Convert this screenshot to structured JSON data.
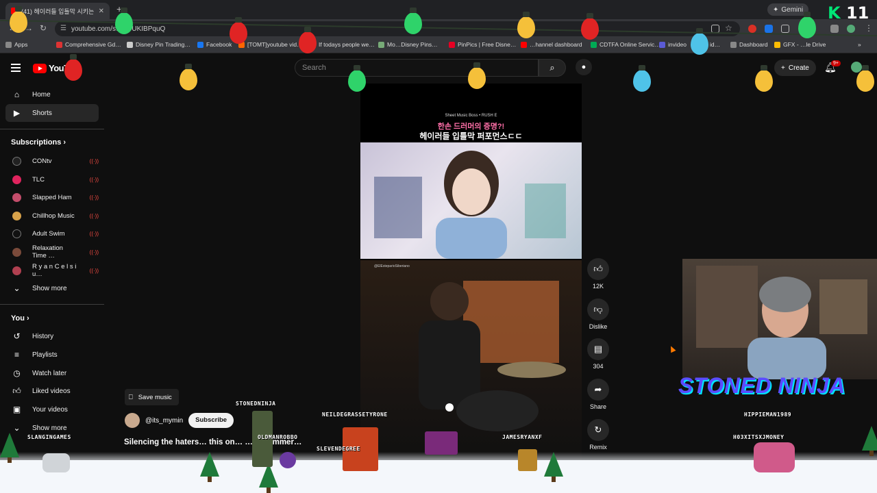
{
  "browser": {
    "tab_title": "(41) 헤이러들 입틀막 시키는",
    "new_tab_symbol": "+",
    "gemini_label": "Gemini",
    "url": "youtube.com/s…EYUKIBPquQ",
    "bookmarks": [
      "Apps",
      "Comprehensive Gd…",
      "Disney Pin Trading…",
      "Facebook",
      "[TOMT]youtube vid…",
      "If todays people we…",
      "Mo…Disney Pins…",
      "PinPics | Free Disne…",
      "…hannel dashboard",
      "CDTFA Online Servic…",
      "invideo",
      "id…",
      "Dashboard",
      "GFX - …le Drive"
    ],
    "stream_counter": "11"
  },
  "header": {
    "logo_text": "YouT",
    "search_placeholder": "Search",
    "create_label": "Create",
    "notif_count": "9+"
  },
  "sidebar": {
    "home": "Home",
    "shorts": "Shorts",
    "subscriptions_title": "Subscriptions",
    "subscriptions": [
      {
        "name": "CONtv",
        "color": "#222222"
      },
      {
        "name": "TLC",
        "color": "#e0245e"
      },
      {
        "name": "Slapped Ham",
        "color": "#c44d6b"
      },
      {
        "name": "Chillhop Music",
        "color": "#d8a24a"
      },
      {
        "name": "Adult Swim",
        "color": "#111111"
      },
      {
        "name": "Relaxation Time …",
        "color": "#7a4a3a"
      },
      {
        "name": "R y a n C e l s i u…",
        "color": "#b04050"
      }
    ],
    "show_more_1": "Show more",
    "you_title": "You",
    "you_items": [
      "History",
      "Playlists",
      "Watch later",
      "Liked videos",
      "Your videos"
    ],
    "show_more_2": "Show more"
  },
  "short": {
    "overlay_label": "Sheet Music Boss • RUSH E",
    "korean_line1": "한손 드러머의 증명?!",
    "korean_line2": "헤이러들 입틀막 퍼포먼스ㄷㄷ",
    "handle_overlay": "@ElEsteparioSiberiano",
    "save_music": "Save music",
    "channel": "@its_mymin",
    "subscribe": "Subscribe",
    "caption": "Silencing the haters… this on… …d drummer…"
  },
  "actions": {
    "likes": "12K",
    "dislike": "Dislike",
    "comments": "304",
    "share": "Share",
    "remix": "Remix"
  },
  "stream_overlay": {
    "streamer_title": "STONED NINJA",
    "usernames": [
      "STONEDNINJA",
      "NEILDEGRASSETYRONE",
      "HIPPIEMAN1989",
      "SLANGINGAMES",
      "OLDMANROBBO",
      "JAMESRYANXF",
      "H03XITSXJMONEY",
      "SLEVENDEGREE"
    ]
  },
  "colors": {
    "bg": "#0f0f0f",
    "yt_red": "#ff0000",
    "live_red": "#ff4e45",
    "ninja_text": "#5a4cff"
  }
}
